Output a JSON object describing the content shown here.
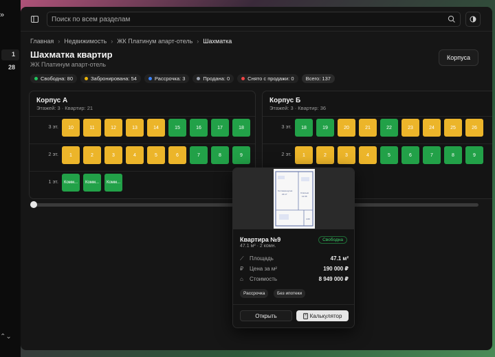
{
  "sidebar": {
    "badges": [
      "1",
      "28"
    ]
  },
  "topbar": {
    "search_placeholder": "Поиск по всем разделам"
  },
  "breadcrumb": [
    "Главная",
    "Недвижимость",
    "ЖК Платинум апарт-отель",
    "Шахматка"
  ],
  "page": {
    "title": "Шахматка квартир",
    "subtitle": "ЖК Платинум апарт-отель",
    "corpus_button": "Корпуса"
  },
  "stats": [
    {
      "label": "Свободна: 80",
      "color": "#22c55e"
    },
    {
      "label": "Забронирована: 54",
      "color": "#eab308"
    },
    {
      "label": "Рассрочка: 3",
      "color": "#3b82f6"
    },
    {
      "label": "Продана: 0",
      "color": "#9ca3af"
    },
    {
      "label": "Снято с продажи: 0",
      "color": "#ef4444"
    },
    {
      "label": "Всего: 137",
      "color": ""
    }
  ],
  "buildings": [
    {
      "title": "Корпус А",
      "subtitle": "Этажей: 3 · Квартир: 21",
      "floors": [
        {
          "label": "3 эт.",
          "cells": [
            {
              "n": "10",
              "s": "yellow"
            },
            {
              "n": "11",
              "s": "yellow"
            },
            {
              "n": "12",
              "s": "yellow"
            },
            {
              "n": "13",
              "s": "yellow"
            },
            {
              "n": "14",
              "s": "yellow"
            },
            {
              "n": "15",
              "s": "green"
            },
            {
              "n": "16",
              "s": "green"
            },
            {
              "n": "17",
              "s": "green"
            },
            {
              "n": "18",
              "s": "green"
            }
          ]
        },
        {
          "label": "2 эт.",
          "cells": [
            {
              "n": "1",
              "s": "yellow"
            },
            {
              "n": "2",
              "s": "yellow"
            },
            {
              "n": "3",
              "s": "yellow"
            },
            {
              "n": "4",
              "s": "yellow"
            },
            {
              "n": "5",
              "s": "yellow"
            },
            {
              "n": "6",
              "s": "yellow"
            },
            {
              "n": "7",
              "s": "green"
            },
            {
              "n": "8",
              "s": "green"
            },
            {
              "n": "9",
              "s": "green"
            }
          ]
        },
        {
          "label": "1 эт.",
          "cells": [
            {
              "n": "Комм...",
              "s": "green"
            },
            {
              "n": "Комм...",
              "s": "green"
            },
            {
              "n": "Комм...",
              "s": "green"
            }
          ]
        }
      ]
    },
    {
      "title": "Корпус Б",
      "subtitle": "Этажей: 3 · Квартир: 36",
      "floors": [
        {
          "label": "3 эт.",
          "cells": [
            {
              "n": "18",
              "s": "green"
            },
            {
              "n": "19",
              "s": "green"
            },
            {
              "n": "20",
              "s": "yellow"
            },
            {
              "n": "21",
              "s": "yellow"
            },
            {
              "n": "22",
              "s": "green"
            },
            {
              "n": "23",
              "s": "yellow"
            },
            {
              "n": "24",
              "s": "yellow"
            },
            {
              "n": "25",
              "s": "yellow"
            },
            {
              "n": "26",
              "s": "yellow"
            }
          ]
        },
        {
          "label": "2 эт.",
          "cells": [
            {
              "n": "1",
              "s": "yellow"
            },
            {
              "n": "2",
              "s": "yellow"
            },
            {
              "n": "3",
              "s": "yellow"
            },
            {
              "n": "4",
              "s": "yellow"
            },
            {
              "n": "5",
              "s": "green"
            },
            {
              "n": "6",
              "s": "green"
            },
            {
              "n": "7",
              "s": "green"
            },
            {
              "n": "8",
              "s": "green"
            },
            {
              "n": "9",
              "s": "green"
            }
          ]
        }
      ]
    }
  ],
  "popover": {
    "title": "Квартира №9",
    "subtitle": "47.1 м² · 2 комн.",
    "status": "Свободна",
    "props": [
      {
        "icon": "ruler-icon",
        "glyph": "⟋",
        "label": "Площадь",
        "value": "47.1 м²"
      },
      {
        "icon": "ruble-icon",
        "glyph": "₽",
        "label": "Цена за м²",
        "value": "190 000 ₽"
      },
      {
        "icon": "house-icon",
        "glyph": "⌂",
        "label": "Стоимость",
        "value": "8 949 000 ₽"
      }
    ],
    "tags": [
      "Рассрочка",
      "Без ипотеки"
    ],
    "open_button": "Открыть",
    "calc_button": "Калькулятор",
    "plan_labels": [
      "Гостиная-кухня",
      "23.17",
      "Спальня",
      "12.36",
      "4.60"
    ]
  },
  "colors": {
    "free": "#22a148",
    "reserved": "#ecb52a"
  }
}
